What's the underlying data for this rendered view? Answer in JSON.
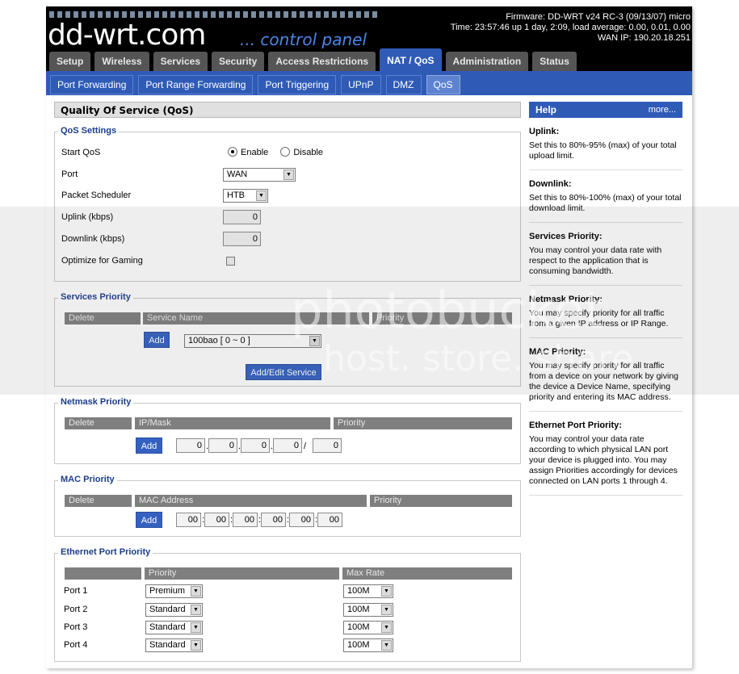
{
  "header": {
    "logo": "dd-wrt.com",
    "logo_sub": "... control panel",
    "firmware": "Firmware: DD-WRT v24 RC-3 (09/13/07) micro",
    "time": "Time: 23:57:46 up 1 day, 2:09, load average: 0.00, 0.01, 0.00",
    "wan_ip": "WAN IP: 190.20.18.251"
  },
  "main_tabs": [
    "Setup",
    "Wireless",
    "Services",
    "Security",
    "Access Restrictions",
    "NAT / QoS",
    "Administration",
    "Status"
  ],
  "sub_tabs": [
    "Port Forwarding",
    "Port Range Forwarding",
    "Port Triggering",
    "UPnP",
    "DMZ",
    "QoS"
  ],
  "page_title": "Quality Of Service (QoS)",
  "qos_settings": {
    "legend": "QoS Settings",
    "start_qos_label": "Start QoS",
    "enable_label": "Enable",
    "disable_label": "Disable",
    "port_label": "Port",
    "port_value": "WAN",
    "scheduler_label": "Packet Scheduler",
    "scheduler_value": "HTB",
    "uplink_label": "Uplink (kbps)",
    "uplink_value": "0",
    "downlink_label": "Downlink (kbps)",
    "downlink_value": "0",
    "gaming_label": "Optimize for Gaming"
  },
  "services_priority": {
    "legend": "Services Priority",
    "col_delete": "Delete",
    "col_service": "Service Name",
    "col_priority": "Priority",
    "add_label": "Add",
    "service_value": "100bao [ 0 ~ 0 ]",
    "edit_label": "Add/Edit Service"
  },
  "netmask_priority": {
    "legend": "Netmask Priority",
    "col_delete": "Delete",
    "col_ip": "IP/Mask",
    "col_priority": "Priority",
    "add_label": "Add",
    "ip": [
      "0",
      "0",
      "0",
      "0"
    ],
    "mask": "0"
  },
  "mac_priority": {
    "legend": "MAC Priority",
    "col_delete": "Delete",
    "col_mac": "MAC Address",
    "col_priority": "Priority",
    "add_label": "Add",
    "mac": [
      "00",
      "00",
      "00",
      "00",
      "00",
      "00"
    ]
  },
  "ethernet_priority": {
    "legend": "Ethernet Port Priority",
    "col_priority": "Priority",
    "col_rate": "Max Rate",
    "ports": [
      {
        "label": "Port 1",
        "priority": "Premium",
        "rate": "100M"
      },
      {
        "label": "Port 2",
        "priority": "Standard",
        "rate": "100M"
      },
      {
        "label": "Port 3",
        "priority": "Standard",
        "rate": "100M"
      },
      {
        "label": "Port 4",
        "priority": "Standard",
        "rate": "100M"
      }
    ]
  },
  "help": {
    "title": "Help",
    "more": "more...",
    "items": [
      {
        "title": "Uplink:",
        "text": "Set this to 80%-95% (max) of your total upload limit."
      },
      {
        "title": "Downlink:",
        "text": "Set this to 80%-100% (max) of your total download limit."
      },
      {
        "title": "Services Priority:",
        "text": "You may control your data rate with respect to the application that is consuming bandwidth."
      },
      {
        "title": "Netmask Priority:",
        "text": "You may specify priority for all traffic from a given IP address or IP Range."
      },
      {
        "title": "MAC Priority:",
        "text": "You may specify priority for all traffic from a device on your network by giving the device a Device Name, specifying priority and entering its MAC address."
      },
      {
        "title": "Ethernet Port Priority:",
        "text": "You may control your data rate according to which physical LAN port your device is plugged into. You may assign Priorities accordingly for devices connected on LAN ports 1 through 4."
      }
    ]
  },
  "watermark": {
    "line1": "photobucket",
    "line2": "host. store. share"
  }
}
